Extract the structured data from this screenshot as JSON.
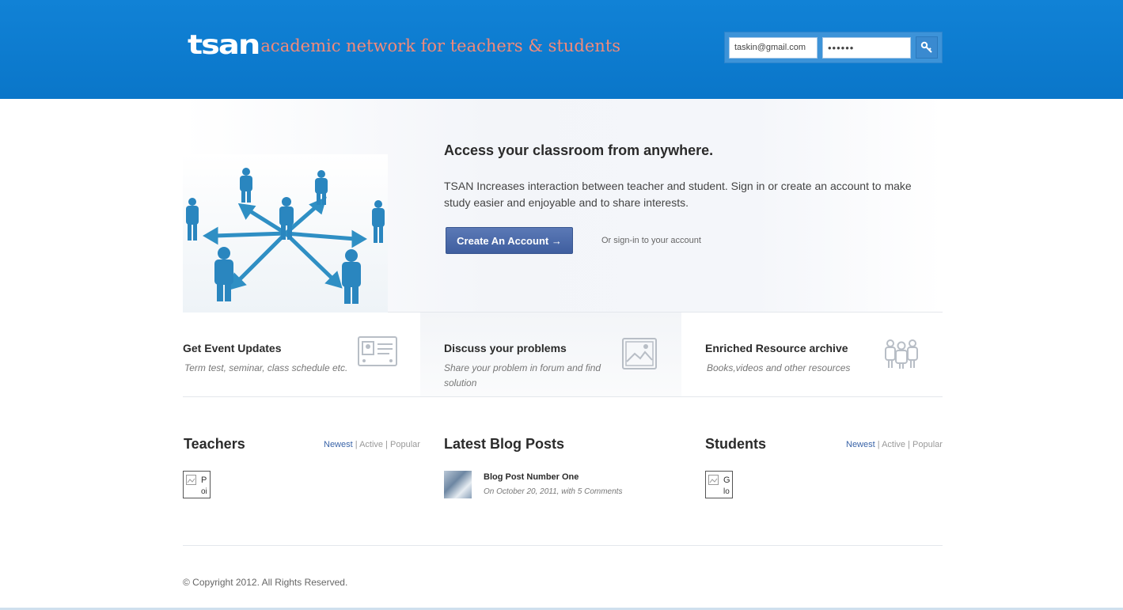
{
  "header": {
    "logo_mark": "tsan",
    "tagline": "academic network for teachers & students",
    "email_value": "taskin@gmail.com",
    "password_value": "••••••"
  },
  "hero": {
    "title": "Access your classroom from anywhere.",
    "text": "TSAN Increases interaction between teacher and student. Sign in or create an account to make study easier and enjoyable and to share interests.",
    "cta_label": "Create An Account →",
    "signin_label": "Or sign-in to your account"
  },
  "features": [
    {
      "title": "Get Event Updates",
      "subtitle": "Term test, seminar, class schedule etc.",
      "icon": "id-card-icon"
    },
    {
      "title": "Discuss your problems",
      "subtitle": "Share your problem in forum and find solution",
      "icon": "picture-icon"
    },
    {
      "title": "Enriched Resource archive",
      "subtitle": "Books,videos and other resources",
      "icon": "people-group-icon"
    }
  ],
  "teachers": {
    "title": "Teachers",
    "filters": [
      "Newest",
      "Active",
      "Popular"
    ],
    "separator": "|",
    "thumb_text_1": "P",
    "thumb_text_2": "oi"
  },
  "blog": {
    "title": "Latest Blog Posts",
    "post_title": "Blog Post Number One",
    "post_meta": "On October 20, 2011, with 5 Comments"
  },
  "students": {
    "title": "Students",
    "filters": [
      "Newest",
      "Active",
      "Popular"
    ],
    "separator": "|",
    "thumb_text_1": "G",
    "thumb_text_2": "lo"
  },
  "footer": {
    "copyright": "© Copyright 2012. All Rights Reserved."
  },
  "colors": {
    "header_blue": "#0a76c9",
    "tagline": "#f28a7a",
    "cta": "#4a68a8",
    "filter_active": "#3a64a8"
  }
}
